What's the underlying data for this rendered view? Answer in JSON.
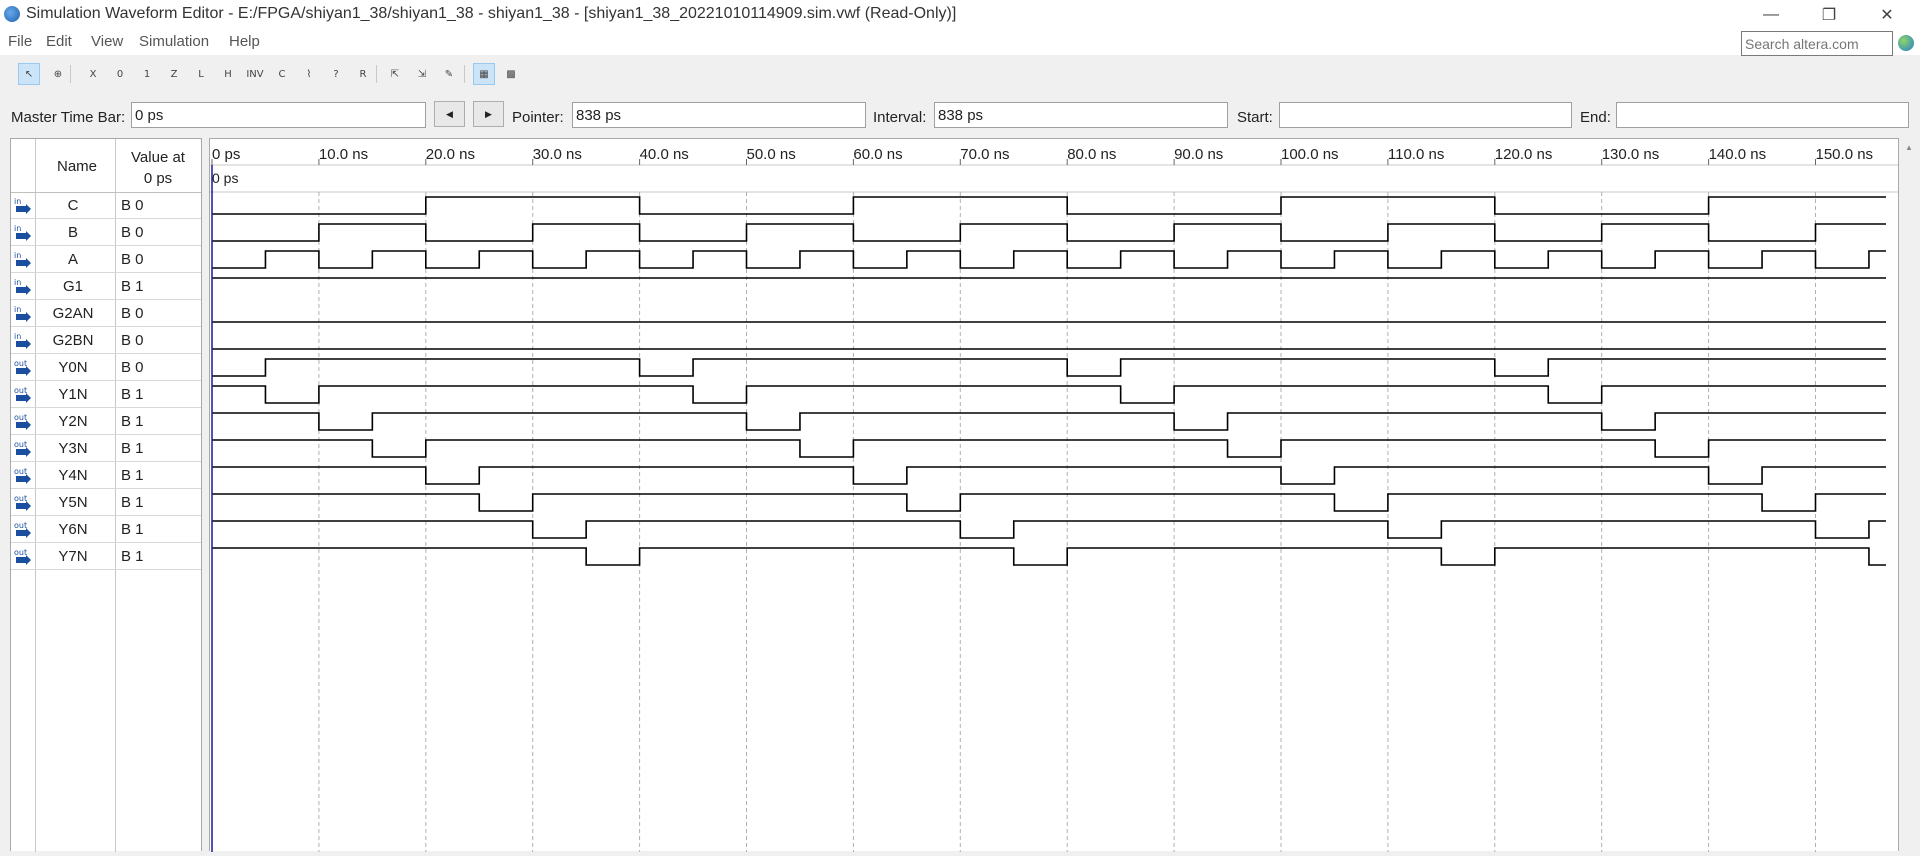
{
  "window": {
    "title": "Simulation Waveform Editor - E:/FPGA/shiyan1_38/shiyan1_38 - shiyan1_38 - [shiyan1_38_20221010114909.sim.vwf (Read-Only)]",
    "minimize_glyph": "—",
    "restore_glyph": "❐",
    "close_glyph": "✕"
  },
  "menu": {
    "items": [
      "File",
      "Edit",
      "View",
      "Simulation",
      "Help"
    ],
    "search_placeholder": "Search altera.com"
  },
  "toolbar": {
    "buttons": [
      {
        "name": "selection-tool-icon",
        "glyph": "↖",
        "active": true
      },
      {
        "name": "zoom-tool-icon",
        "glyph": "⊕",
        "active": false
      },
      {
        "name": "force-unknown-icon",
        "glyph": "X",
        "active": false
      },
      {
        "name": "force-low-icon",
        "glyph": "0",
        "active": false
      },
      {
        "name": "force-high-icon",
        "glyph": "1",
        "active": false
      },
      {
        "name": "high-impedance-icon",
        "glyph": "Z",
        "active": false
      },
      {
        "name": "weak-low-icon",
        "glyph": "L",
        "active": false
      },
      {
        "name": "weak-high-icon",
        "glyph": "H",
        "active": false
      },
      {
        "name": "invert-icon",
        "glyph": "INV",
        "active": false
      },
      {
        "name": "count-value-icon",
        "glyph": "C",
        "active": false
      },
      {
        "name": "clock-value-icon",
        "glyph": "⌇",
        "active": false
      },
      {
        "name": "arbitrary-value-icon",
        "glyph": "?",
        "active": false
      },
      {
        "name": "random-value-icon",
        "glyph": "R",
        "active": false
      },
      {
        "name": "snap-to-grid-icon",
        "glyph": "⇱",
        "active": false
      },
      {
        "name": "snap-transition-icon",
        "glyph": "⇲",
        "active": false
      },
      {
        "name": "edit-tool-icon",
        "glyph": "✎",
        "active": false
      },
      {
        "name": "grid-settings-icon",
        "glyph": "▦",
        "active": true
      },
      {
        "name": "group-settings-icon",
        "glyph": "▩",
        "active": false
      }
    ]
  },
  "timebar": {
    "master_label": "Master Time Bar:",
    "master_value": "0 ps",
    "prev_glyph": "◀",
    "next_glyph": "▶",
    "pointer_label": "Pointer:",
    "pointer_value": "838 ps",
    "interval_label": "Interval:",
    "interval_value": "838 ps",
    "start_label": "Start:",
    "start_value": "",
    "end_label": "End:",
    "end_value": ""
  },
  "signal_table": {
    "name_header": "Name",
    "value_header_line1": "Value at",
    "value_header_line2": "0 ps",
    "signals": [
      {
        "name": "C",
        "dir": "in",
        "value": "B 0"
      },
      {
        "name": "B",
        "dir": "in",
        "value": "B 0"
      },
      {
        "name": "A",
        "dir": "in",
        "value": "B 0"
      },
      {
        "name": "G1",
        "dir": "in",
        "value": "B 1"
      },
      {
        "name": "G2AN",
        "dir": "in",
        "value": "B 0"
      },
      {
        "name": "G2BN",
        "dir": "in",
        "value": "B 0"
      },
      {
        "name": "Y0N",
        "dir": "out",
        "value": "B 0"
      },
      {
        "name": "Y1N",
        "dir": "out",
        "value": "B 1"
      },
      {
        "name": "Y2N",
        "dir": "out",
        "value": "B 1"
      },
      {
        "name": "Y3N",
        "dir": "out",
        "value": "B 1"
      },
      {
        "name": "Y4N",
        "dir": "out",
        "value": "B 1"
      },
      {
        "name": "Y5N",
        "dir": "out",
        "value": "B 1"
      },
      {
        "name": "Y6N",
        "dir": "out",
        "value": "B 1"
      },
      {
        "name": "Y7N",
        "dir": "out",
        "value": "B 1"
      }
    ]
  },
  "waveform": {
    "time_marker_label": "0 ps",
    "time_unit": "ns",
    "visible_range_ns": [
      0,
      156.5
    ],
    "tick_labels": [
      "0 ps",
      "10.0 ns",
      "20.0 ns",
      "30.0 ns",
      "40.0 ns",
      "50.0 ns",
      "60.0 ns",
      "70.0 ns",
      "80.0 ns",
      "90.0 ns",
      "100.0 ns",
      "110.0 ns",
      "120.0 ns",
      "130.0 ns",
      "140.0 ns",
      "150.0 ns"
    ],
    "tick_times_ns": [
      0,
      10,
      20,
      30,
      40,
      50,
      60,
      70,
      80,
      90,
      100,
      110,
      120,
      130,
      140,
      150
    ],
    "grid_dashed": true,
    "signals": {
      "C": {
        "initial": 0,
        "transitions_ns": [
          20,
          40,
          60,
          80,
          100,
          120,
          140
        ]
      },
      "B": {
        "initial": 0,
        "transitions_ns": [
          10,
          20,
          30,
          40,
          50,
          60,
          70,
          80,
          90,
          100,
          110,
          120,
          130,
          140,
          150
        ]
      },
      "A": {
        "initial": 0,
        "transitions_ns": [
          5,
          10,
          15,
          20,
          25,
          30,
          35,
          40,
          45,
          50,
          55,
          60,
          65,
          70,
          75,
          80,
          85,
          90,
          95,
          100,
          105,
          110,
          115,
          120,
          125,
          130,
          135,
          140,
          145,
          150,
          155
        ]
      },
      "G1": {
        "initial": 1,
        "transitions_ns": []
      },
      "G2AN": {
        "initial": 0,
        "transitions_ns": []
      },
      "G2BN": {
        "initial": 0,
        "transitions_ns": []
      },
      "Y0N": {
        "initial": 0,
        "transitions_ns": [
          5,
          40,
          45,
          80,
          85,
          120,
          125
        ]
      },
      "Y1N": {
        "initial": 1,
        "transitions_ns": [
          5,
          10,
          45,
          50,
          85,
          90,
          125,
          130
        ]
      },
      "Y2N": {
        "initial": 1,
        "transitions_ns": [
          10,
          15,
          50,
          55,
          90,
          95,
          130,
          135
        ]
      },
      "Y3N": {
        "initial": 1,
        "transitions_ns": [
          15,
          20,
          55,
          60,
          95,
          100,
          135,
          140
        ]
      },
      "Y4N": {
        "initial": 1,
        "transitions_ns": [
          20,
          25,
          60,
          65,
          100,
          105,
          140,
          145
        ]
      },
      "Y5N": {
        "initial": 1,
        "transitions_ns": [
          25,
          30,
          65,
          70,
          105,
          110,
          145,
          150
        ]
      },
      "Y6N": {
        "initial": 1,
        "transitions_ns": [
          30,
          35,
          70,
          75,
          110,
          115,
          150,
          155
        ]
      },
      "Y7N": {
        "initial": 1,
        "transitions_ns": [
          35,
          40,
          75,
          80,
          115,
          120,
          155
        ]
      }
    },
    "colors": {
      "wave": "#000000",
      "cursor": "#1a1a99",
      "grid": "#b0b0b0"
    }
  }
}
